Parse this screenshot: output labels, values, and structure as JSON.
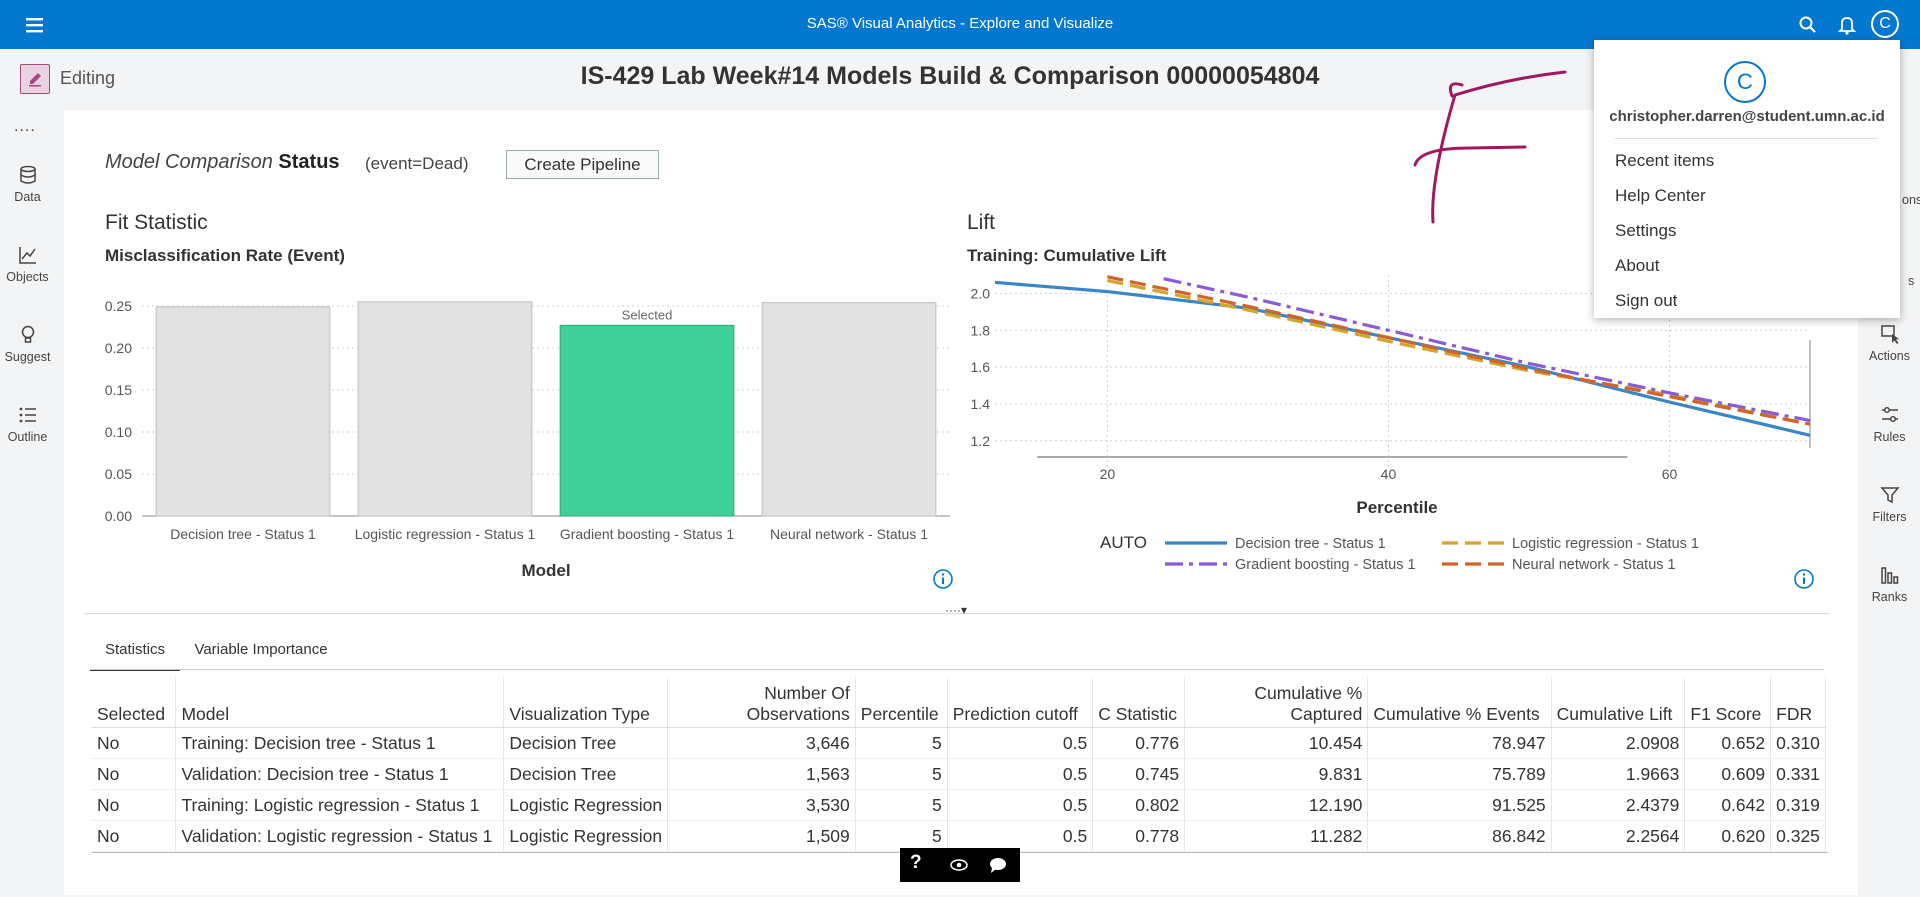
{
  "topbar": {
    "app_title": "SAS® Visual Analytics - Explore and Visualize",
    "avatar_letter": "C"
  },
  "editbar": {
    "mode_label": "Editing",
    "report_title": "IS-429 Lab Week#14 Models Build & Comparison 00000054804"
  },
  "left_rail": {
    "more": "....",
    "items": [
      {
        "label": "Data",
        "icon": "database-icon"
      },
      {
        "label": "Objects",
        "icon": "chart-icon"
      },
      {
        "label": "Suggest",
        "icon": "lightbulb-icon"
      },
      {
        "label": "Outline",
        "icon": "list-icon"
      }
    ]
  },
  "right_rail": {
    "partial_top": "ons",
    "partial_second": "s",
    "items": [
      {
        "label": "Actions",
        "icon": "actions-icon"
      },
      {
        "label": "Rules",
        "icon": "rules-icon"
      },
      {
        "label": "Filters",
        "icon": "filter-icon"
      },
      {
        "label": "Ranks",
        "icon": "ranks-icon"
      }
    ]
  },
  "model_comparison": {
    "heading_italic": "Model Comparison",
    "heading_bold": "Status",
    "event": "(event=Dead)",
    "create_pipeline": "Create Pipeline"
  },
  "fit_statistic": {
    "section_title": "Fit Statistic",
    "subtitle": "Misclassification Rate (Event)",
    "selected_label": "Selected",
    "info_icon": "info-icon"
  },
  "lift": {
    "section_title": "Lift",
    "subtitle": "Training: Cumulative Lift",
    "legend_title": "AUTO",
    "info_icon": "info-icon"
  },
  "annotation": {
    "letter": "F",
    "color": "#a0195e"
  },
  "chart_data": [
    {
      "type": "bar",
      "title": "Misclassification Rate (Event)",
      "xlabel": "Model",
      "ylabel": "",
      "categories": [
        "Decision tree - Status 1",
        "Logistic regression - Status 1",
        "Gradient boosting - Status 1",
        "Neural network - Status 1"
      ],
      "values": [
        0.249,
        0.255,
        0.227,
        0.254
      ],
      "selected_index": 2,
      "ylim": [
        0,
        0.25
      ],
      "yticks": [
        "0.00",
        "0.05",
        "0.10",
        "0.15",
        "0.20",
        "0.25"
      ],
      "colors": {
        "bar": "#e2e2e2",
        "selected": "#3fcf97"
      },
      "grid": true
    },
    {
      "type": "line",
      "title": "Training: Cumulative Lift",
      "xlabel": "Percentile",
      "ylabel": "",
      "xticks": [
        20,
        40,
        60
      ],
      "yticks": [
        "1.2",
        "1.4",
        "1.6",
        "1.8",
        "2.0"
      ],
      "xlim": [
        12,
        70
      ],
      "ylim": [
        1.15,
        2.1
      ],
      "grid": true,
      "legend_position": "bottom",
      "series": [
        {
          "name": "Decision tree - Status 1",
          "color": "#3a87c8",
          "dash": "solid",
          "x": [
            12,
            20,
            30,
            40,
            50,
            60,
            70
          ],
          "y": [
            2.06,
            2.01,
            1.92,
            1.76,
            1.6,
            1.41,
            1.23
          ]
        },
        {
          "name": "Logistic regression - Status 1",
          "color": "#d4a52b",
          "dash": "dashed",
          "x": [
            20,
            30,
            40,
            50,
            60,
            70
          ],
          "y": [
            2.07,
            1.91,
            1.74,
            1.58,
            1.45,
            1.29
          ]
        },
        {
          "name": "Gradient boosting - Status 1",
          "color": "#8a5bd6",
          "dash": "dashdot",
          "x": [
            24,
            30,
            40,
            50,
            60,
            70
          ],
          "y": [
            2.08,
            1.98,
            1.8,
            1.62,
            1.46,
            1.31
          ]
        },
        {
          "name": "Neural network - Status 1",
          "color": "#d0642a",
          "dash": "dashed",
          "x": [
            20,
            30,
            40,
            50,
            60,
            70
          ],
          "y": [
            2.09,
            1.93,
            1.76,
            1.59,
            1.44,
            1.29
          ]
        }
      ]
    }
  ],
  "tabs": [
    {
      "label": "Statistics",
      "active": true
    },
    {
      "label": "Variable Importance",
      "active": false
    }
  ],
  "table": {
    "columns": [
      "Selected",
      "Model",
      "Visualization Type",
      "Number Of Observations",
      "Percentile",
      "Prediction cutoff",
      "C Statistic",
      "Cumulative % Captured",
      "Cumulative % Events",
      "Cumulative Lift",
      "F1 Score",
      "FDR"
    ],
    "rows": [
      [
        "No",
        "Training: Decision tree - Status 1",
        "Decision Tree",
        "3,646",
        "5",
        "0.5",
        "0.776",
        "10.454",
        "78.947",
        "2.0908",
        "0.652",
        "0.310"
      ],
      [
        "No",
        "Validation: Decision tree - Status 1",
        "Decision Tree",
        "1,563",
        "5",
        "0.5",
        "0.745",
        "9.831",
        "75.789",
        "1.9663",
        "0.609",
        "0.331"
      ],
      [
        "No",
        "Training: Logistic regression - Status 1",
        "Logistic Regression",
        "3,530",
        "5",
        "0.5",
        "0.802",
        "12.190",
        "91.525",
        "2.4379",
        "0.642",
        "0.319"
      ],
      [
        "No",
        "Validation: Logistic regression - Status 1",
        "Logistic Regression",
        "1,509",
        "5",
        "0.5",
        "0.778",
        "11.282",
        "86.842",
        "2.2564",
        "0.620",
        "0.325"
      ]
    ]
  },
  "help_bar": {
    "help": "?",
    "icons": [
      "eye-icon",
      "chat-icon"
    ]
  },
  "user_menu": {
    "avatar_letter": "C",
    "email": "christopher.darren@student.umn.ac.id",
    "items": [
      "Recent items",
      "Help Center",
      "Settings",
      "About",
      "Sign out"
    ]
  }
}
